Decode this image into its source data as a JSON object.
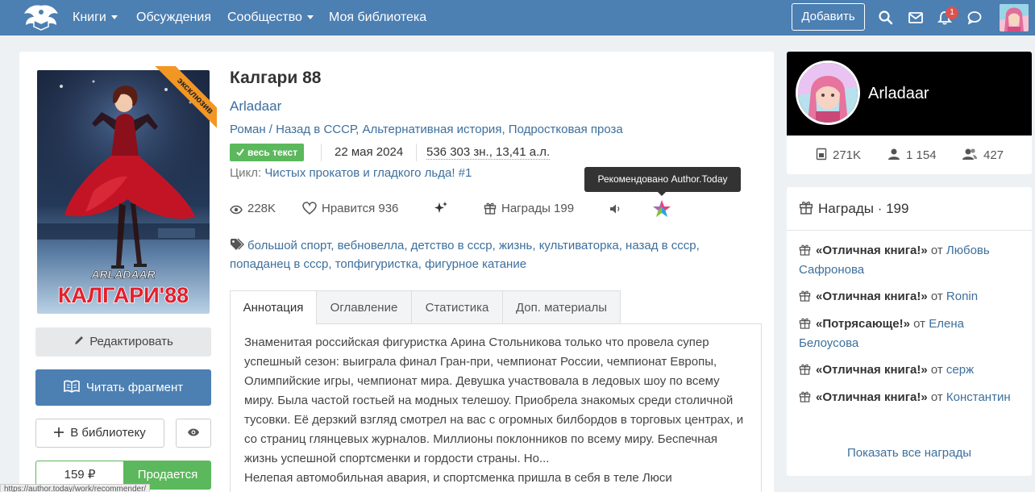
{
  "nav": {
    "books": "Книги",
    "discussions": "Обсуждения",
    "community": "Сообщество",
    "library": "Моя библиотека",
    "add_button": "Добавить",
    "notifications_count": "1"
  },
  "book": {
    "title": "Калгари 88",
    "author": "Arladaar",
    "genres": [
      "Роман",
      "Назад в СССР",
      "Альтернативная история",
      "Подростковая проза"
    ],
    "status_badge": "весь текст",
    "date": "22 мая 2024",
    "size": "536 303 зн., 13,41 а.л.",
    "cycle_label": "Цикл:",
    "cycle_name": "Чистых прокатов и гладкого льда! #1",
    "ribbon": "эксклюзив",
    "cover_author": "ARLADAAR",
    "cover_title": "КАЛГАРИ'88"
  },
  "stats": {
    "views": "228K",
    "likes": "Нравится 936",
    "awards": "Награды 199"
  },
  "tooltip": "Рекомендовано Author.Today",
  "tags": [
    "большой спорт",
    "вебновелла",
    "детство в ссср",
    "жизнь",
    "культиваторка",
    "назад в ссср",
    "попаданец в ссср",
    "топфигуристка",
    "фигурное катание"
  ],
  "buttons": {
    "edit": "Редактировать",
    "read": "Читать фрагмент",
    "library": "В библиотеку",
    "price": "159 ₽",
    "sale": "Продается"
  },
  "tabs": [
    "Аннотация",
    "Оглавление",
    "Статистика",
    "Доп. материалы"
  ],
  "annotation": [
    "Знаменитая российская фигуристка Арина Стольникова только что провела супер успешный сезон: выиграла финал Гран-при, чемпионат России, чемпионат Европы, Олимпийские игры, чемпионат мира. Девушка участвовала в ледовых шоу по всему миру. Была частой гостьей на модных телешоу. Приобрела знакомых среди столичной тусовки. Её дерзкий взгляд смотрел на вас с огромных билбордов в торговых центрах, и со страниц глянцевых журналов. Миллионы поклонников по всему миру. Беспечная жизнь успешной спортсменки и гордости страны. Но...",
    "Нелепая автомобильная авария, и спортсменка пришла в себя в теле Люси Хмельницкой, совсем юной фигуристки, перворазрядницы из захолустного уральского"
  ],
  "status_url": "https://author.today/work/recommender/",
  "author_card": {
    "name": "Arladaar",
    "books": "271K",
    "followers": "1 154",
    "friends": "427"
  },
  "awards": {
    "title": "Награды",
    "count": "199",
    "from": "от",
    "items": [
      {
        "name": "«Отличная книга!»",
        "user": "Любовь Сафронова"
      },
      {
        "name": "«Отличная книга!»",
        "user": "Ronin"
      },
      {
        "name": "«Потрясающе!»",
        "user": "Елена Белоусова"
      },
      {
        "name": "«Отличная книга!»",
        "user": "серж"
      },
      {
        "name": "«Отличная книга!»",
        "user": "Константин"
      }
    ],
    "show_all": "Показать все награды"
  },
  "colors": {
    "nav": "#4c7fb2",
    "link": "#3d6f9c",
    "success": "#5cb85c",
    "ribbon": "#f29624"
  }
}
